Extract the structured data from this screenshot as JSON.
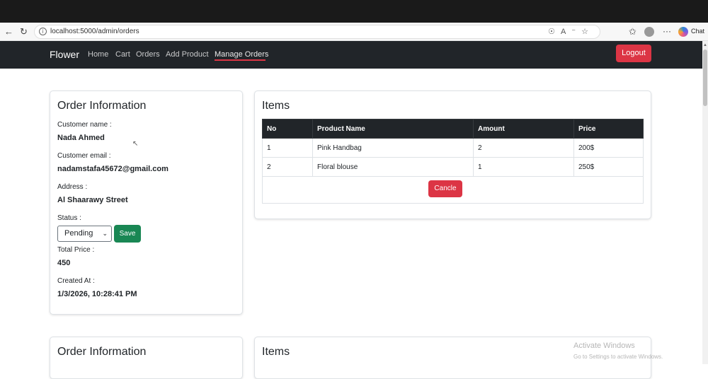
{
  "browser": {
    "url": "localhost:5000/admin/orders",
    "chat_label": "Chat"
  },
  "navbar": {
    "brand": "Flower",
    "links": [
      "Home",
      "Cart",
      "Orders",
      "Add Product",
      "Manage Orders"
    ],
    "active": "Manage Orders",
    "logout_label": "Logout"
  },
  "order": {
    "title": "Order Information",
    "customer_name_label": "Customer name :",
    "customer_name": "Nada Ahmed",
    "customer_email_label": "Customer email :",
    "customer_email": "nadamstafa45672@gmail.com",
    "address_label": "Address :",
    "address": "Al Shaarawy Street",
    "status_label": "Status :",
    "status_value": "Pending",
    "save_label": "Save",
    "total_price_label": "Total Price :",
    "total_price": "450",
    "created_at_label": "Created At :",
    "created_at": "1/3/2026, 10:28:41 PM"
  },
  "items": {
    "title": "Items",
    "columns": [
      "No",
      "Product Name",
      "Amount",
      "Price"
    ],
    "rows": [
      [
        "1",
        "Pink Handbag",
        "2",
        "200$"
      ],
      [
        "2",
        "Floral blouse",
        "1",
        "250$"
      ]
    ],
    "cancel_label": "Cancle"
  },
  "second_order": {
    "title": "Order Information",
    "items_title": "Items"
  },
  "watermark": {
    "line1": "Activate Windows",
    "line2": "Go to Settings to activate Windows."
  },
  "colors": {
    "navbar": "#212529",
    "danger": "#dc3545",
    "success": "#198754"
  },
  "icons": [
    "back-arrow-icon",
    "refresh-icon",
    "info-icon",
    "location-icon",
    "read-aloud-icon",
    "favorite-star-icon",
    "favorites-icon",
    "profile-avatar-icon",
    "more-icon",
    "copilot-icon",
    "cursor-icon",
    "chevron-down-icon"
  ]
}
